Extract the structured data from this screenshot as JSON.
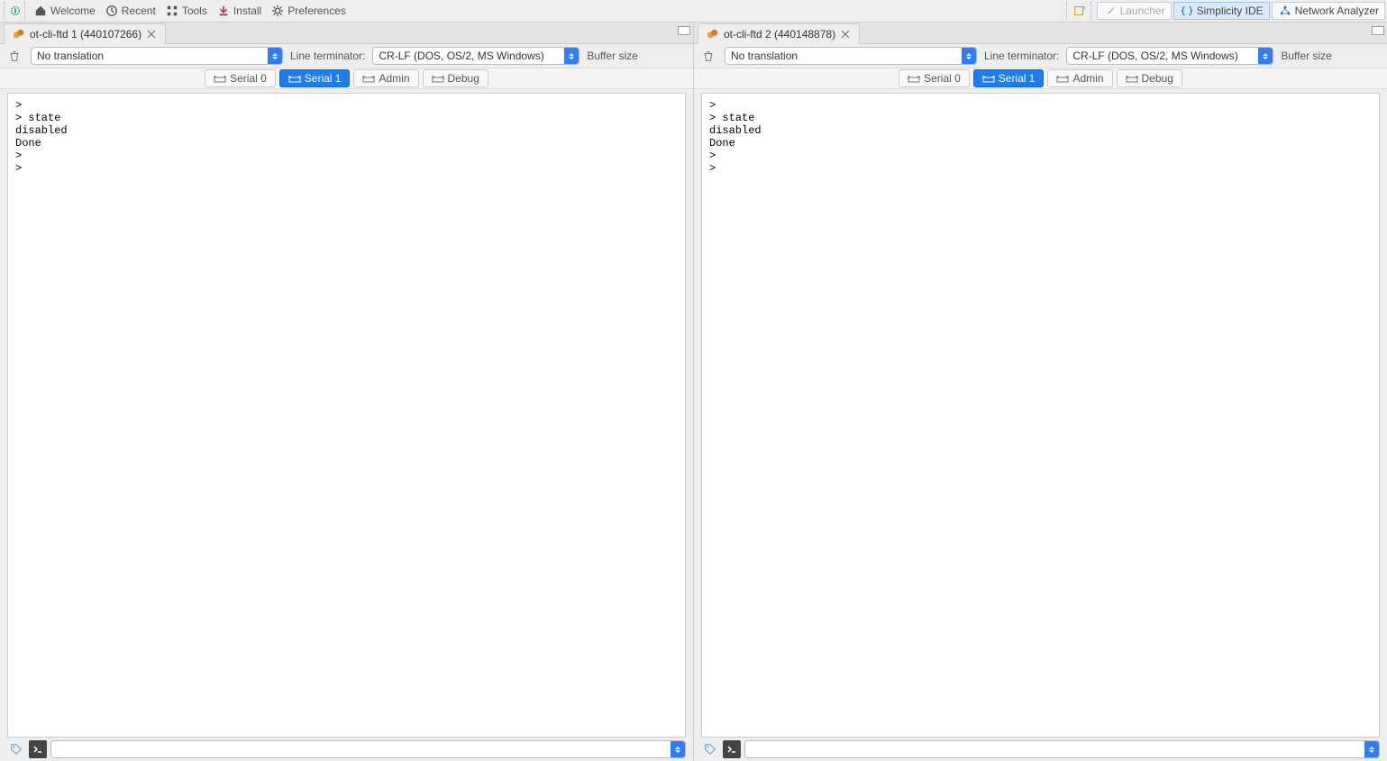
{
  "toolbar": {
    "left": [
      {
        "label": "Welcome",
        "icon": "home"
      },
      {
        "label": "Recent",
        "icon": "clock"
      },
      {
        "label": "Tools",
        "icon": "grid"
      },
      {
        "label": "Install",
        "icon": "download"
      },
      {
        "label": "Preferences",
        "icon": "gear"
      }
    ],
    "right": {
      "launcher": "Launcher",
      "ide": "Simplicity IDE",
      "analyzer": "Network Analyzer"
    }
  },
  "panes": [
    {
      "tab_title": "ot-cli-ftd 1 (440107266)",
      "translation_select": "No translation",
      "line_terminator_label": "Line terminator:",
      "line_terminator_select": "CR-LF  (DOS, OS/2, MS Windows)",
      "buffer_label": "Buffer size",
      "port_tabs": [
        "Serial 0",
        "Serial 1",
        "Admin",
        "Debug"
      ],
      "active_port_tab": 1,
      "console_text": ">\n> state\ndisabled\nDone\n>\n>",
      "cmd_value": ""
    },
    {
      "tab_title": "ot-cli-ftd 2 (440148878)",
      "translation_select": "No translation",
      "line_terminator_label": "Line terminator:",
      "line_terminator_select": "CR-LF  (DOS, OS/2, MS Windows)",
      "buffer_label": "Buffer size",
      "port_tabs": [
        "Serial 0",
        "Serial 1",
        "Admin",
        "Debug"
      ],
      "active_port_tab": 1,
      "console_text": ">\n> state\ndisabled\nDone\n>\n>",
      "cmd_value": ""
    }
  ]
}
